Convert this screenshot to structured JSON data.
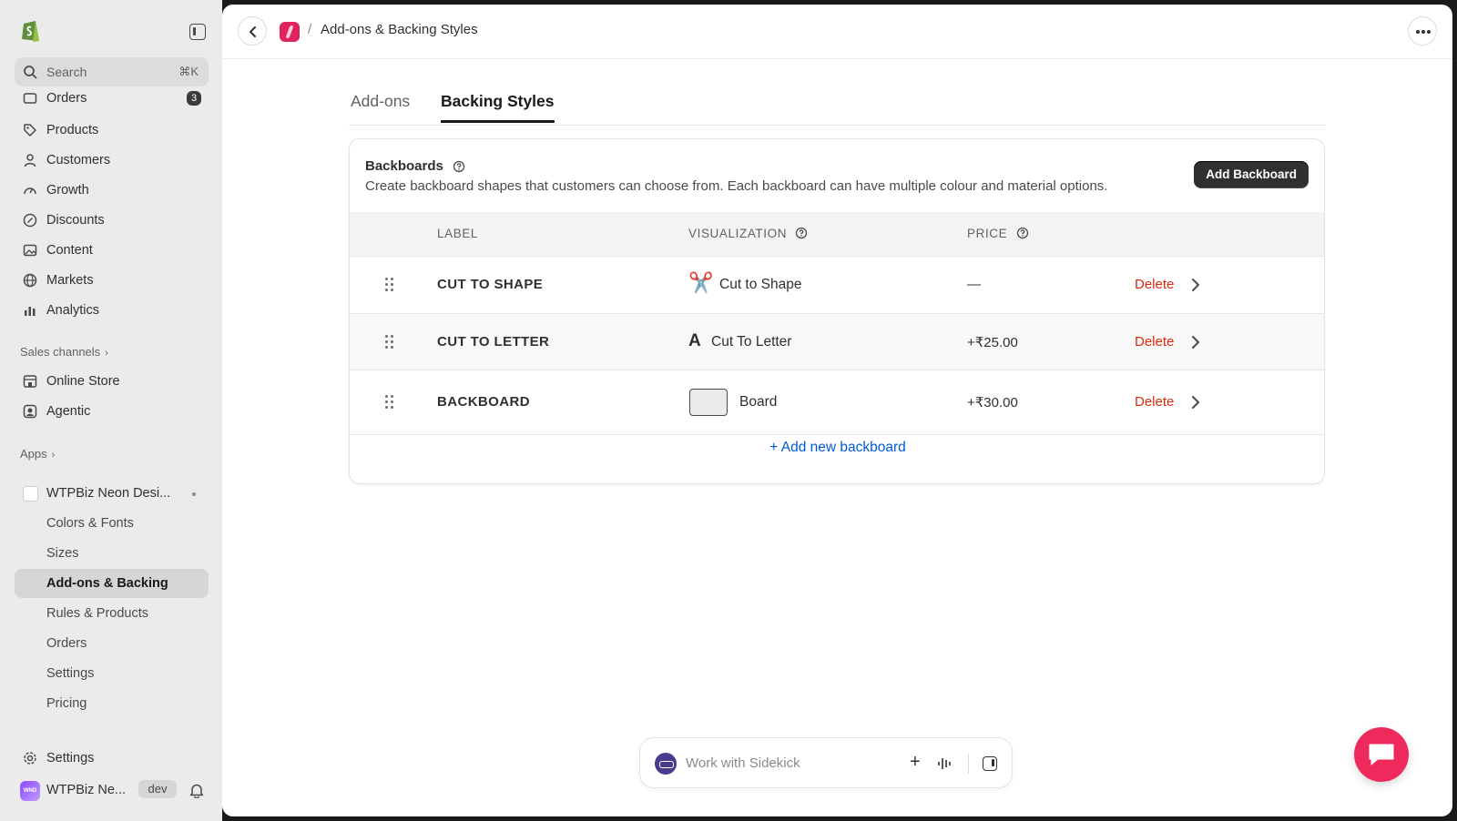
{
  "sidebar": {
    "search": {
      "label": "Search",
      "shortcut": "⌘K"
    },
    "orders": {
      "label": "Orders",
      "badge": "3"
    },
    "nav": [
      {
        "label": "Products",
        "icon": "tag-icon"
      },
      {
        "label": "Customers",
        "icon": "person-icon"
      },
      {
        "label": "Growth",
        "icon": "gauge-icon"
      },
      {
        "label": "Discounts",
        "icon": "discount-icon"
      },
      {
        "label": "Content",
        "icon": "image-icon"
      },
      {
        "label": "Markets",
        "icon": "globe-icon"
      },
      {
        "label": "Analytics",
        "icon": "bar-chart-icon"
      }
    ],
    "sales_channels_label": "Sales channels",
    "channels": [
      {
        "label": "Online Store",
        "icon": "store-icon"
      },
      {
        "label": "Agentic",
        "icon": "agent-icon"
      }
    ],
    "apps_label": "Apps",
    "app": {
      "label": "WTPBiz Neon Desi..."
    },
    "app_pages": [
      "Colors & Fonts",
      "Sizes",
      "Add-ons & Backing",
      "Rules & Products",
      "Orders",
      "Settings",
      "Pricing"
    ],
    "settings_label": "Settings",
    "store": {
      "name": "WTPBiz Ne...",
      "badge": "dev",
      "avatar_text": "WND"
    }
  },
  "topbar": {
    "breadcrumb": "Add-ons & Backing Styles",
    "separator": "/"
  },
  "tabs": [
    {
      "label": "Add-ons",
      "active": false
    },
    {
      "label": "Backing Styles",
      "active": true
    }
  ],
  "card": {
    "title": "Backboards",
    "description": "Create backboard shapes that customers can choose from. Each backboard can have multiple colour and material options.",
    "add_button": "Add Backboard",
    "columns": {
      "label": "LABEL",
      "visualization": "VISUALIZATION",
      "price": "PRICE"
    },
    "rows": [
      {
        "label": "CUT TO SHAPE",
        "vis_glyph": "✂️",
        "vis_text": "Cut to Shape",
        "price": "—",
        "action": "Delete"
      },
      {
        "label": "CUT TO LETTER",
        "vis_glyph": "A",
        "vis_text": "Cut To Letter",
        "price": "+₹25.00",
        "action": "Delete"
      },
      {
        "label": "BACKBOARD",
        "vis_glyph": "",
        "vis_text": "Board",
        "price": "+₹30.00",
        "action": "Delete"
      }
    ],
    "add_new": "+ Add new backboard"
  },
  "sidekick": {
    "placeholder": "Work with Sidekick"
  },
  "colors": {
    "accent_link": "#005bd3",
    "danger": "#d82c0d",
    "fab": "#ee2a5c"
  }
}
